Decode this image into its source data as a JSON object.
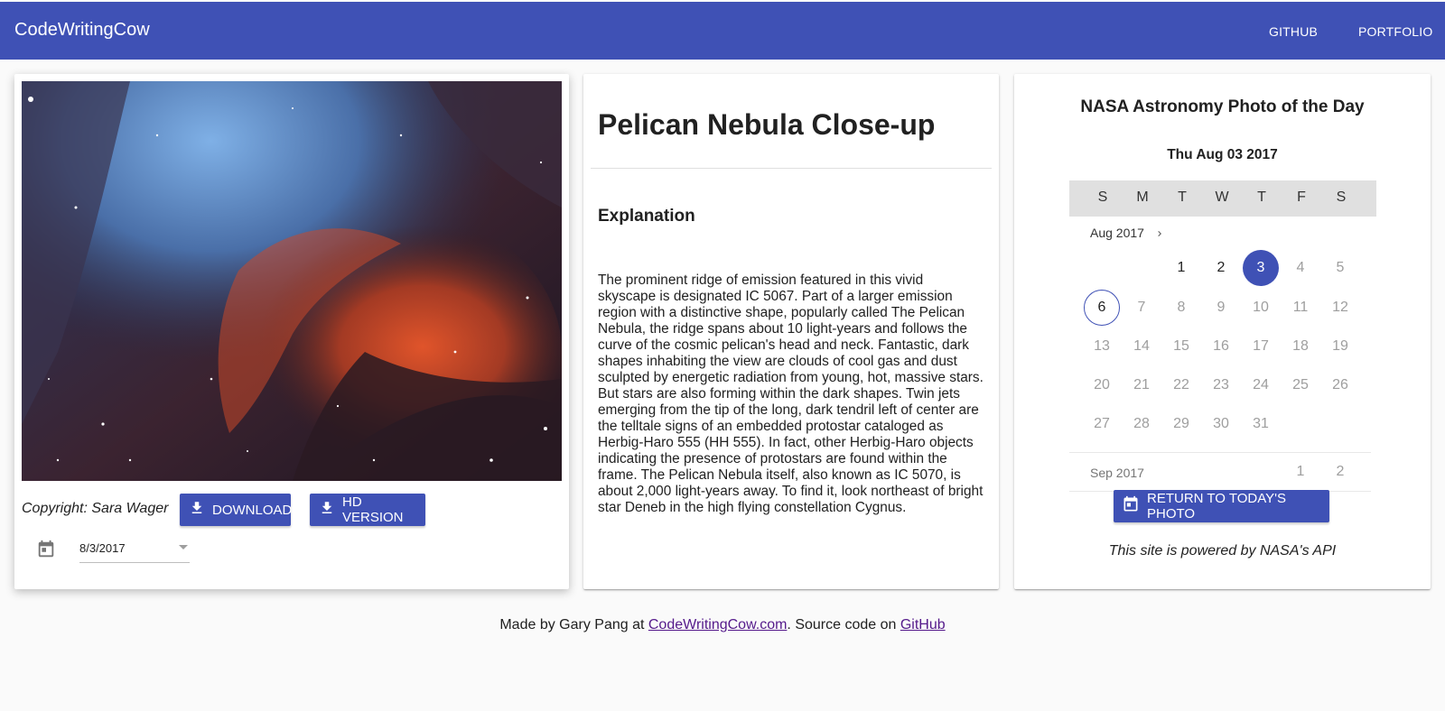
{
  "appbar": {
    "brand": "CodeWritingCow",
    "nav": [
      "GITHUB",
      "PORTFOLIO"
    ]
  },
  "colors": {
    "primary": "#3f51b5",
    "background": "#fafafa",
    "link": "#551a8b"
  },
  "photo_card": {
    "image_alt_icon": "nebula-photo",
    "copyright": "Copyright: Sara Wager",
    "download_label": "DOWNLOAD",
    "hd_label": "HD VERSION",
    "date_value": "8/3/2017"
  },
  "article": {
    "title": "Pelican Nebula Close-up",
    "explanation_heading": "Explanation",
    "explanation": "The prominent ridge of emission featured in this vivid skyscape is designated IC 5067. Part of a larger emission region with a distinctive shape, popularly called The Pelican Nebula, the ridge spans about 10 light-years and follows the curve of the cosmic pelican's head and neck. Fantastic, dark shapes inhabiting the view are clouds of cool gas and dust sculpted by energetic radiation from young, hot, massive stars. But stars are also forming within the dark shapes. Twin jets emerging from the tip of the long, dark tendril left of center are the telltale signs of an embedded protostar cataloged as Herbig-Haro 555 (HH 555). In fact, other Herbig-Haro objects indicating the presence of protostars are found within the frame. The Pelican Nebula itself, also known as IC 5070, is about 2,000 light-years away. To find it, look northeast of bright star Deneb in the high flying constellation Cygnus."
  },
  "calendar": {
    "heading": "NASA Astronomy Photo of the Day",
    "selected_date_label": "Thu Aug 03 2017",
    "weekdays": [
      "S",
      "M",
      "T",
      "W",
      "T",
      "F",
      "S"
    ],
    "current_month": "Aug 2017",
    "next_month": "Sep 2017",
    "aug_days": [
      "1",
      "2",
      "3",
      "4",
      "5",
      "6",
      "7",
      "8",
      "9",
      "10",
      "11",
      "12",
      "13",
      "14",
      "15",
      "16",
      "17",
      "18",
      "19",
      "20",
      "21",
      "22",
      "23",
      "24",
      "25",
      "26",
      "27",
      "28",
      "29",
      "30",
      "31"
    ],
    "sep_days": [
      "1",
      "2"
    ],
    "selected_day": "3",
    "today_day": "6",
    "return_label": "RETURN TO TODAY'S PHOTO",
    "powered": "This site is powered by NASA's API"
  },
  "footer": {
    "prefix": "Made by Gary Pang at ",
    "site_link": "CodeWritingCow.com",
    "middle": ". Source code on ",
    "github_link": "GitHub"
  }
}
